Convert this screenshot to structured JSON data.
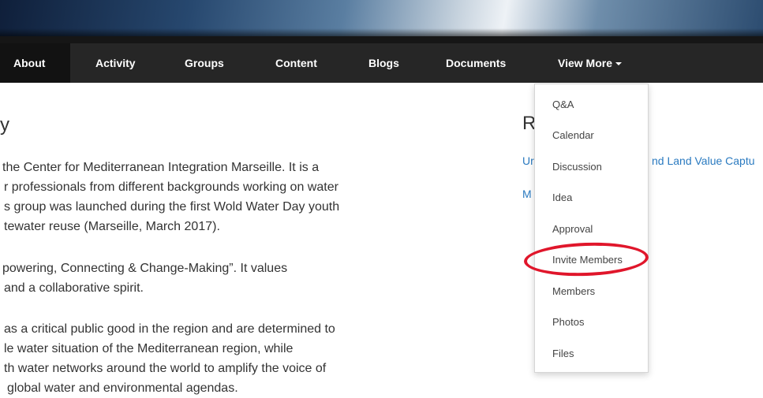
{
  "nav": {
    "items": [
      {
        "label": "About",
        "active": true
      },
      {
        "label": "Activity"
      },
      {
        "label": "Groups"
      },
      {
        "label": "Content"
      },
      {
        "label": "Blogs"
      },
      {
        "label": "Documents"
      },
      {
        "label": "View More"
      }
    ]
  },
  "main": {
    "title": "y",
    "paragraph1": [
      "the Center for Mediterranean Integration Marseille. It is a",
      "r professionals from different backgrounds working on water",
      "s group was launched during the first Wold Water Day youth",
      "tewater reuse (Marseille, March 2017)."
    ],
    "paragraph2": [
      "powering, Connecting & Change-Making”. It values",
      "and a collaborative spirit."
    ],
    "paragraph3": [
      "as a critical public good in the region and are determined to",
      "le water situation of the Mediterranean region, while",
      "th water networks around the world to amplify the voice of",
      "global water and environmental agendas."
    ]
  },
  "sidebar": {
    "title": "R",
    "link1_prefix": "Ur",
    "link1_suffix": "nd Land Value Captu",
    "link2_prefix": "M"
  },
  "dropdown": {
    "items": [
      "Q&A",
      "Calendar",
      "Discussion",
      "Idea",
      "Approval",
      "Invite Members",
      "Members",
      "Photos",
      "Files"
    ],
    "highlighted": "Invite Members"
  },
  "colors": {
    "nav_bg": "#262626",
    "active_bg": "#121212",
    "link": "#2a7ac0",
    "annotation": "#e0162b"
  }
}
